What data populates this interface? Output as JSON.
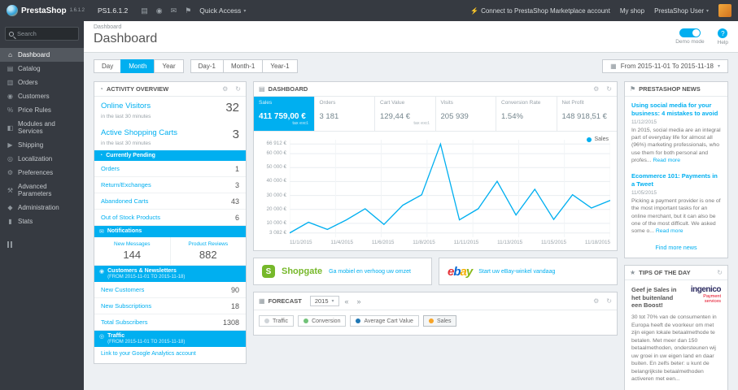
{
  "colors": {
    "accent": "#00aff0",
    "topbar": "#363a41",
    "sales_line": "#00aff0"
  },
  "icons": {
    "caret": "▾",
    "bolt": "⚡",
    "cart": "▤",
    "person": "◉",
    "mail": "✉",
    "flag": "⚑",
    "calendar": "▦",
    "gear": "⚙",
    "refresh": "↻",
    "help": "?",
    "home": "⌂",
    "catalog": "▤",
    "orders": "▥",
    "customers": "◉",
    "price_rules": "%",
    "modules": "◧",
    "shipping": "▶",
    "localization": "◎",
    "preferences": "⚙",
    "advanced_parameters": "⚒",
    "administration": "◆",
    "stats": "▮",
    "activity": "◔",
    "dashboard": "▤",
    "forecast": "▦",
    "news": "⚑",
    "tips": "★",
    "pending": "◔",
    "notifications": "✉",
    "customers_sec": "◉",
    "traffic": "◎",
    "prev": "«",
    "next": "»"
  },
  "topbar": {
    "brand": "PrestaShop",
    "brand_version": "1.6.1.2",
    "shop_name": "PS1.6.1.2",
    "quick_access_label": "Quick Access",
    "marketplace_link": "Connect to PrestaShop Marketplace account",
    "my_shop_label": "My shop",
    "user_label": "PrestaShop User"
  },
  "sidebar": {
    "search_placeholder": "Search",
    "items": [
      {
        "label": "Dashboard"
      },
      {
        "label": "Catalog"
      },
      {
        "label": "Orders"
      },
      {
        "label": "Customers"
      },
      {
        "label": "Price Rules"
      },
      {
        "label": "Modules and Services"
      },
      {
        "label": "Shipping"
      },
      {
        "label": "Localization"
      },
      {
        "label": "Preferences"
      },
      {
        "label": "Advanced Parameters"
      },
      {
        "label": "Administration"
      },
      {
        "label": "Stats"
      }
    ]
  },
  "header": {
    "breadcrumb": "Dashboard",
    "title": "Dashboard",
    "demo_mode_label": "Demo mode",
    "help_label": "Help"
  },
  "toolbar": {
    "range_buttons": [
      "Day",
      "Month",
      "Year"
    ],
    "offset_buttons": [
      "Day-1",
      "Month-1",
      "Year-1"
    ],
    "active_button": "Month",
    "date_range": "From 2015-11-01 To 2015-11-18"
  },
  "activity": {
    "panel_title": "ACTIVITY OVERVIEW",
    "online_visitors_label": "Online Visitors",
    "online_visitors_value": "32",
    "online_visitors_sub": "in the last 30 minutes",
    "active_carts_label": "Active Shopping Carts",
    "active_carts_value": "3",
    "active_carts_sub": "in the last 30 minutes",
    "pending": {
      "title": "Currently Pending",
      "rows": [
        {
          "label": "Orders",
          "value": "1"
        },
        {
          "label": "Return/Exchanges",
          "value": "3"
        },
        {
          "label": "Abandoned Carts",
          "value": "43"
        },
        {
          "label": "Out of Stock Products",
          "value": "6"
        }
      ]
    },
    "notifications": {
      "title": "Notifications",
      "cols": [
        {
          "label": "New Messages",
          "value": "144"
        },
        {
          "label": "Product Reviews",
          "value": "882"
        }
      ]
    },
    "customers": {
      "title": "Customers & Newsletters",
      "subtitle": "(FROM 2015-11-01 TO 2015-11-18)",
      "rows": [
        {
          "label": "New Customers",
          "value": "90"
        },
        {
          "label": "New Subscriptions",
          "value": "18"
        },
        {
          "label": "Total Subscribers",
          "value": "1308"
        }
      ]
    },
    "traffic": {
      "title": "Traffic",
      "subtitle": "(FROM 2015-11-01 TO 2015-11-18)",
      "link": "Link to your Google Analytics account"
    }
  },
  "dashboard_panel": {
    "panel_title": "DASHBOARD",
    "kpis": [
      {
        "label": "Sales",
        "value": "411 759,00 €",
        "sub": "tax excl."
      },
      {
        "label": "Orders",
        "value": "3 181"
      },
      {
        "label": "Cart Value",
        "value": "129,44 €",
        "sub": "tax excl."
      },
      {
        "label": "Visits",
        "value": "205 939"
      },
      {
        "label": "Conversion Rate",
        "value": "1.54%"
      },
      {
        "label": "Net Profit",
        "value": "148 918,51 €"
      }
    ]
  },
  "chart_data": {
    "type": "line",
    "title": "Sales",
    "x": [
      "11/1/2015",
      "11/2/2015",
      "11/3/2015",
      "11/4/2015",
      "11/5/2015",
      "11/6/2015",
      "11/7/2015",
      "11/8/2015",
      "11/9/2015",
      "11/10/2015",
      "11/11/2015",
      "11/12/2015",
      "11/13/2015",
      "11/14/2015",
      "11/15/2015",
      "11/16/2015",
      "11/17/2015",
      "11/18/2015"
    ],
    "series": [
      {
        "name": "Sales",
        "color": "#00aff0",
        "values": [
          3082,
          10800,
          5600,
          12400,
          20500,
          9200,
          23000,
          30500,
          66912,
          12500,
          20500,
          40200,
          16000,
          34500,
          12800,
          30500,
          21000,
          26500
        ]
      }
    ],
    "y_ticks": [
      {
        "label": "66 912 €",
        "value": 66912
      },
      {
        "label": "60 000 €",
        "value": 60000
      },
      {
        "label": "50 000 €",
        "value": 50000
      },
      {
        "label": "40 000 €",
        "value": 40000
      },
      {
        "label": "30 000 €",
        "value": 30000
      },
      {
        "label": "20 000 €",
        "value": 20000
      },
      {
        "label": "10 000 €",
        "value": 10000
      },
      {
        "label": "3 082 €",
        "value": 3082
      }
    ],
    "x_tick_labels": [
      "11/1/2015",
      "11/4/2015",
      "11/6/2015",
      "11/8/2015",
      "11/11/2015",
      "11/13/2015",
      "11/15/2015",
      "11/18/2015"
    ],
    "ylim": [
      0,
      70000
    ],
    "grid": true,
    "legend_position": "top-right"
  },
  "promos": {
    "shopgate": {
      "initial": "S",
      "name": "Shopgate",
      "link": "Ga mobiel en verhoog uw omzet"
    },
    "ebay": {
      "letters": [
        "e",
        "b",
        "a",
        "y"
      ],
      "link": "Start uw eBay-winkel vandaag"
    }
  },
  "forecast": {
    "panel_title": "FORECAST",
    "year": "2015",
    "legend": [
      {
        "label": "Traffic",
        "color": "#cfd4d8"
      },
      {
        "label": "Conversion",
        "color": "#72c279"
      },
      {
        "label": "Average Cart Value",
        "color": "#1f77b4"
      },
      {
        "label": "Sales",
        "color": "#f7a428"
      }
    ]
  },
  "news": {
    "panel_title": "PRESTASHOP NEWS",
    "articles": [
      {
        "title": "Using social media for your business: 4 mistakes to avoid",
        "date": "11/12/2015",
        "excerpt": "In 2015, social media are an integral part of everyday life for almost all (96%) marketing professionals, who use them for both personal and profes...",
        "read_more": "Read more"
      },
      {
        "title": "Ecommerce 101: Payments in a Tweet",
        "date": "11/05/2015",
        "excerpt": "Picking a payment provider is one of the most important tasks for an online merchant, but it can also be one of the most difficult. We asked some o...",
        "read_more": "Read more"
      }
    ],
    "footer_link": "Find more news"
  },
  "tips": {
    "panel_title": "TIPS OF THE DAY",
    "headline": "Geef je Sales in het buitenland een Boost!",
    "brand": "ingenico",
    "brand_sub": "Payment services",
    "body": "30 tot 70% van de consumenten in Europa heeft de voorkeur om met zijn eigen lokale betaalmethode te betalen. Met meer dan 150 betaalmethoden, ondersteunen wij uw groei in uw eigen land en daar buiten. En zelfs beter: u kunt de belangrijkste betaalmethoden activeren met een..."
  }
}
